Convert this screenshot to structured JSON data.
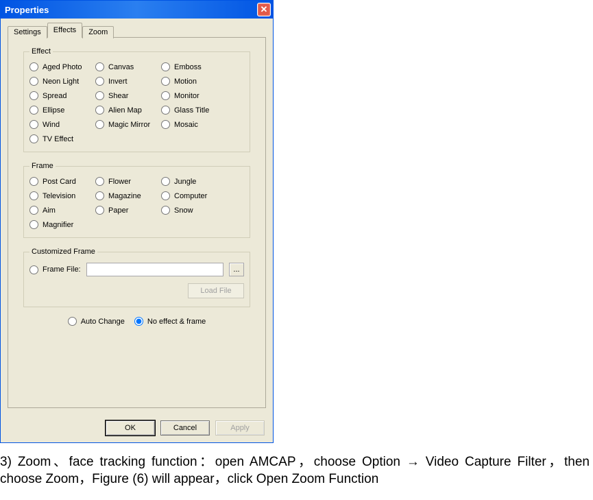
{
  "dialog": {
    "title": "Properties",
    "close_symbol": "✕",
    "tabs": [
      {
        "label": "Settings"
      },
      {
        "label": "Effects"
      },
      {
        "label": "Zoom"
      }
    ],
    "active_tab": 1,
    "effect_group": {
      "legend": "Effect",
      "items": [
        "Aged Photo",
        "Canvas",
        "Emboss",
        "Neon Light",
        "Invert",
        "Motion",
        "Spread",
        "Shear",
        "Monitor",
        "Ellipse",
        "Alien Map",
        "Glass Title",
        "Wind",
        "Magic Mirror",
        "Mosaic",
        "TV Effect"
      ]
    },
    "frame_group": {
      "legend": "Frame",
      "items": [
        "Post Card",
        "Flower",
        "Jungle",
        "Television",
        "Magazine",
        "Computer",
        "Aim",
        "Paper",
        "Snow",
        "Magnifier"
      ]
    },
    "custom_group": {
      "legend": "Customized Frame",
      "radio_label": "Frame File:",
      "file_value": "",
      "browse_label": "...",
      "loadfile_label": "Load File"
    },
    "mode_row": {
      "auto_label": "Auto Change",
      "noeffect_label": "No effect & frame",
      "selected": "noeffect"
    },
    "buttons": {
      "ok": "OK",
      "cancel": "Cancel",
      "apply": "Apply"
    }
  },
  "doc_text": "3) Zoom、face tracking function：open AMCAP，choose Option → Video Capture Filter，then choose Zoom，Figure (6) will appear，click Open Zoom Function"
}
